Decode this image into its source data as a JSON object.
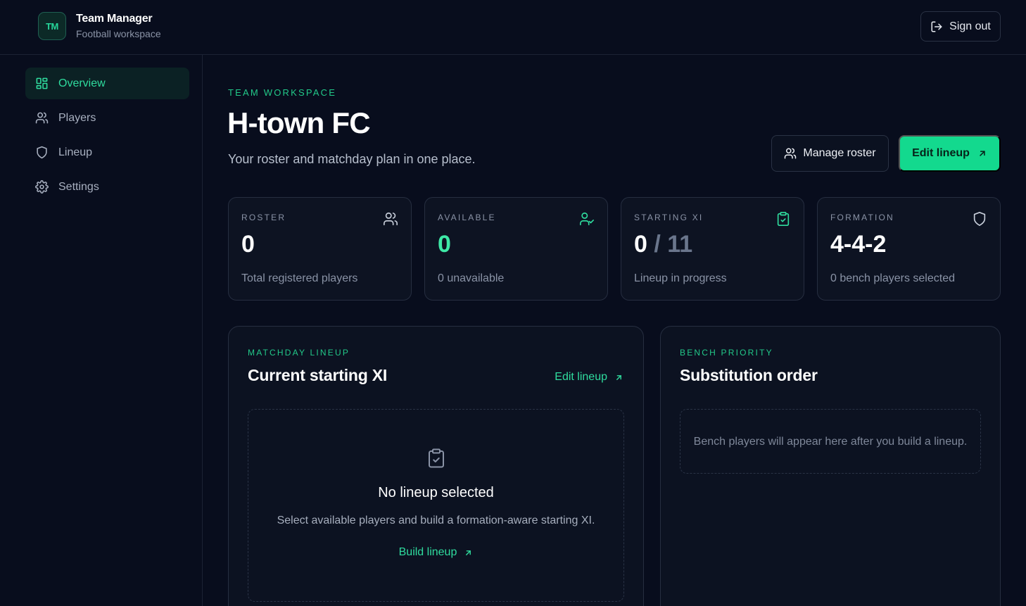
{
  "app": {
    "logo_text": "TM",
    "title": "Team Manager",
    "subtitle": "Football workspace",
    "sign_out_label": "Sign out"
  },
  "sidebar": {
    "items": [
      {
        "label": "Overview",
        "icon": "grid-icon",
        "active": true
      },
      {
        "label": "Players",
        "icon": "users-icon",
        "active": false
      },
      {
        "label": "Lineup",
        "icon": "shield-icon",
        "active": false
      },
      {
        "label": "Settings",
        "icon": "gear-icon",
        "active": false
      }
    ]
  },
  "hero": {
    "eyebrow": "TEAM WORKSPACE",
    "title": "H-town FC",
    "subtitle": "Your roster and matchday plan in one place.",
    "manage_roster_label": "Manage roster",
    "edit_lineup_label": "Edit lineup"
  },
  "stats": [
    {
      "label": "ROSTER",
      "value": "0",
      "footer": "Total registered players",
      "icon": "users-icon"
    },
    {
      "label": "AVAILABLE",
      "value": "0",
      "footer": "0 unavailable",
      "icon": "user-check-icon"
    },
    {
      "label": "STARTING XI",
      "value": "0",
      "value_suffix": "/ 11",
      "footer": "Lineup in progress",
      "icon": "clipboard-check-icon"
    },
    {
      "label": "FORMATION",
      "value": "4-4-2",
      "footer": "0 bench players selected",
      "icon": "shield-icon"
    }
  ],
  "lineup_panel": {
    "eyebrow": "MATCHDAY LINEUP",
    "title": "Current starting XI",
    "link_label": "Edit lineup",
    "empty_title": "No lineup selected",
    "empty_desc": "Select available players and build a formation-aware starting XI.",
    "empty_link": "Build lineup"
  },
  "bench_panel": {
    "eyebrow": "BENCH PRIORITY",
    "title": "Substitution order",
    "empty_text": "Bench players will appear here after you build a lineup."
  },
  "colors": {
    "background": "#080d1d",
    "accent": "#13d98e",
    "accent_text": "#2fdc9e",
    "card": "#0d1322",
    "border": "#262e40"
  }
}
